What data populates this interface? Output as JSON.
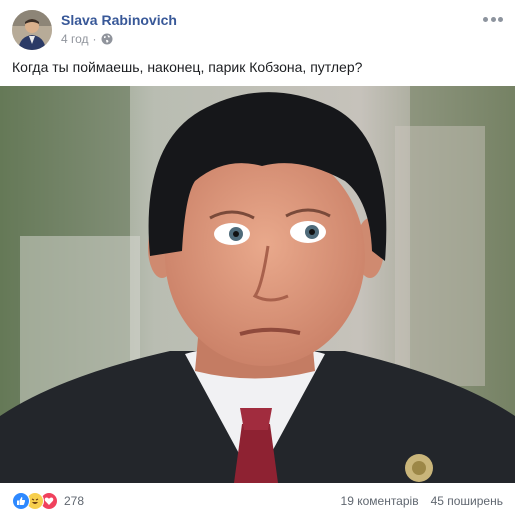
{
  "post": {
    "author": "Slava Rabinovich",
    "time": "4 год",
    "privacy_icon": "globe-icon",
    "text": "Когда ты поймаешь, наконец, парик Кобзона, путлер?"
  },
  "reactions": {
    "icons": [
      "like-icon",
      "haha-icon",
      "love-icon"
    ],
    "count": "278"
  },
  "stats": {
    "comments": "19 коментарів",
    "shares": "45 поширень"
  },
  "colors": {
    "author": "#385898",
    "meta": "#90949c",
    "like": "#2e89ff",
    "haha": "#f7cf4d",
    "love": "#f0415d"
  }
}
